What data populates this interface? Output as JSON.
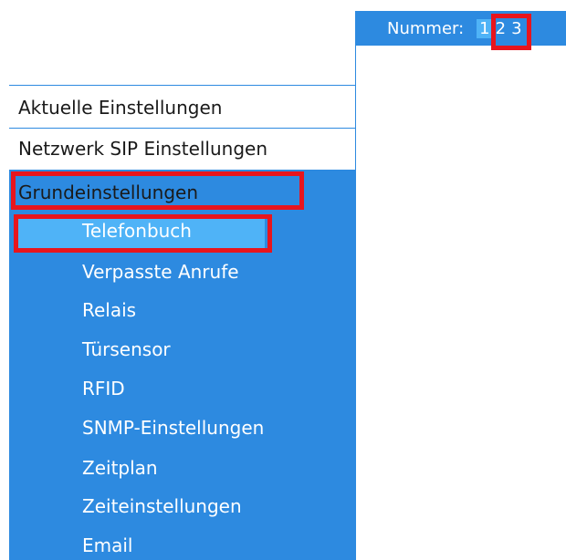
{
  "header": {
    "number_label": "Nummer:",
    "pages": [
      "1",
      "2",
      "3"
    ],
    "active_page": "1"
  },
  "menu": {
    "items": [
      {
        "label": "Aktuelle Einstellungen"
      },
      {
        "label": "Netzwerk SIP Einstellungen"
      }
    ],
    "group": {
      "label": "Grundeinstellungen",
      "subitems": [
        {
          "label": "Telefonbuch",
          "selected": true
        },
        {
          "label": "Verpasste Anrufe"
        },
        {
          "label": "Relais"
        },
        {
          "label": "Türsensor"
        },
        {
          "label": "RFID"
        },
        {
          "label": "SNMP-Einstellungen"
        },
        {
          "label": "Zeitplan"
        },
        {
          "label": "Zeiteinstellungen"
        },
        {
          "label": "Email"
        }
      ]
    }
  },
  "colors": {
    "panel_blue": "#2d8ae0",
    "highlight_blue": "#4fb3f7",
    "annotation_red": "#e8151d"
  }
}
